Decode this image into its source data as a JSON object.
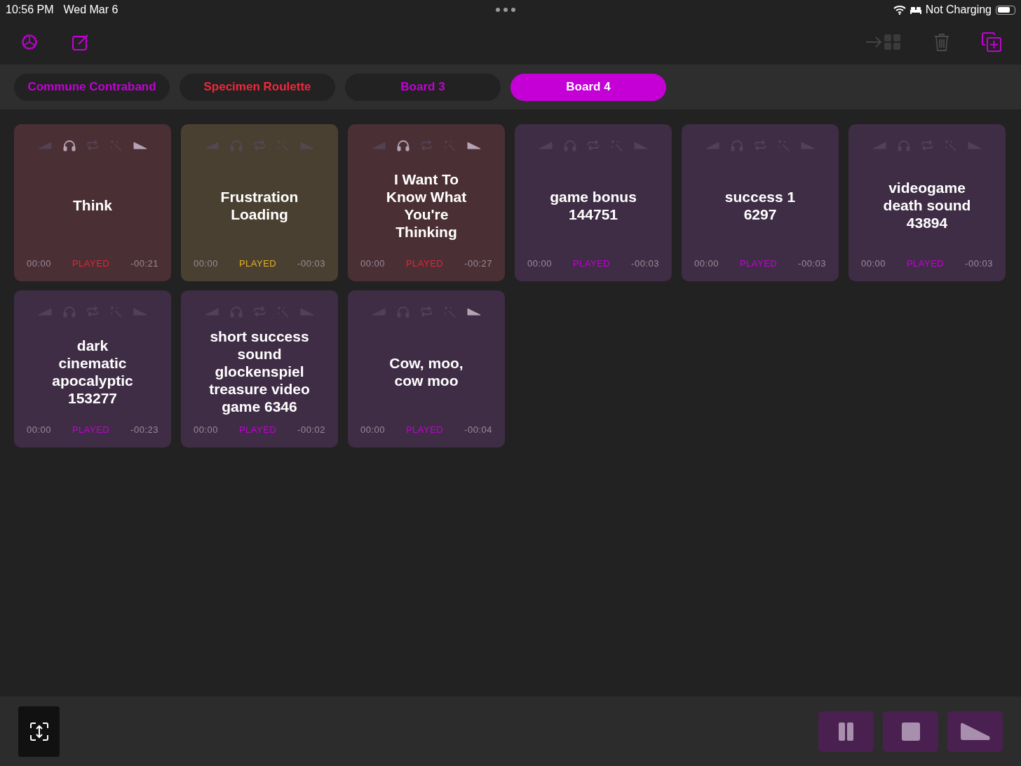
{
  "status_bar": {
    "time": "10:56 PM",
    "date": "Wed Mar 6",
    "battery_text": "Not Charging"
  },
  "tabs": [
    {
      "label": "Commune Contraband",
      "color": "#c400d6",
      "selected": false
    },
    {
      "label": "Specimen Roulette",
      "color": "#f0283c",
      "selected": false
    },
    {
      "label": "Board 3",
      "color": "#c400d6",
      "selected": false
    },
    {
      "label": "Board 4",
      "color": "#c400d6",
      "selected": true
    }
  ],
  "cards": [
    {
      "title": "Think",
      "color": "#4a2f35",
      "status": {
        "text": "PLAYED",
        "color": "#e0283a"
      },
      "elapsed": "00:00",
      "remaining": "-00:21",
      "fade_in": false,
      "headphones": true,
      "loop": false,
      "effects": false,
      "fade_out": true
    },
    {
      "title": "Frustration Loading",
      "color": "#4a4031",
      "status": {
        "text": "PLAYED",
        "color": "#e8b020"
      },
      "elapsed": "00:00",
      "remaining": "-00:03",
      "fade_in": false,
      "headphones": false,
      "loop": false,
      "effects": false,
      "fade_out": false
    },
    {
      "title": "I Want To Know What You're Thinking",
      "color": "#4a2f35",
      "status": {
        "text": "PLAYED",
        "color": "#e0283a"
      },
      "elapsed": "00:00",
      "remaining": "-00:27",
      "fade_in": false,
      "headphones": true,
      "loop": false,
      "effects": false,
      "fade_out": true
    },
    {
      "title": "game bonus 144751",
      "color": "#3f2d45",
      "status": {
        "text": "PLAYED",
        "color": "#c400d6"
      },
      "elapsed": "00:00",
      "remaining": "-00:03",
      "fade_in": false,
      "headphones": false,
      "loop": false,
      "effects": false,
      "fade_out": false
    },
    {
      "title": "success 1 6297",
      "color": "#3f2d45",
      "status": {
        "text": "PLAYED",
        "color": "#c400d6"
      },
      "elapsed": "00:00",
      "remaining": "-00:03",
      "fade_in": false,
      "headphones": false,
      "loop": false,
      "effects": false,
      "fade_out": false
    },
    {
      "title": "videogame death sound 43894",
      "color": "#3f2d45",
      "status": {
        "text": "PLAYED",
        "color": "#c400d6"
      },
      "elapsed": "00:00",
      "remaining": "-00:03",
      "fade_in": false,
      "headphones": false,
      "loop": false,
      "effects": false,
      "fade_out": false
    },
    {
      "title": "dark cinematic apocalyptic 153277",
      "color": "#3f2d45",
      "status": {
        "text": "PLAYED",
        "color": "#c400d6"
      },
      "elapsed": "00:00",
      "remaining": "-00:23",
      "fade_in": false,
      "headphones": false,
      "loop": false,
      "effects": false,
      "fade_out": false
    },
    {
      "title": "short success sound glockenspiel treasure video game 6346",
      "color": "#3f2d45",
      "status": {
        "text": "PLAYED",
        "color": "#c400d6"
      },
      "elapsed": "00:00",
      "remaining": "-00:02",
      "fade_in": false,
      "headphones": false,
      "loop": false,
      "effects": false,
      "fade_out": false
    },
    {
      "title": "Cow, moo, cow moo",
      "color": "#3f2d45",
      "status": {
        "text": "PLAYED",
        "color": "#c400d6"
      },
      "elapsed": "00:00",
      "remaining": "-00:04",
      "fade_in": false,
      "headphones": false,
      "loop": false,
      "effects": false,
      "fade_out": true
    }
  ]
}
